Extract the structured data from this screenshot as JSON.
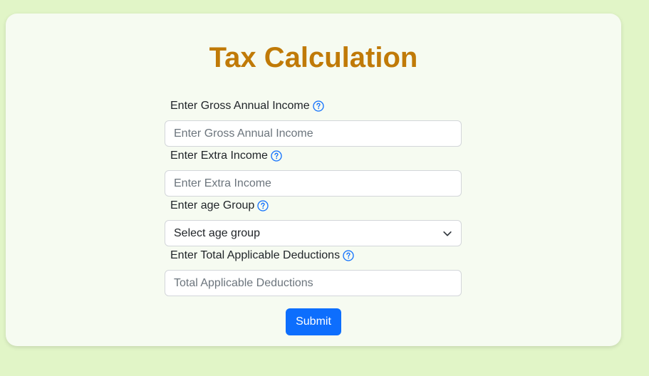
{
  "form": {
    "title": "Tax Calculation",
    "gross_income": {
      "label": "Enter Gross Annual Income",
      "placeholder": "Enter Gross Annual Income",
      "value": ""
    },
    "extra_income": {
      "label": "Enter Extra Income",
      "placeholder": "Enter Extra Income",
      "value": ""
    },
    "age_group": {
      "label": "Enter age Group",
      "selected": "Select age group"
    },
    "deductions": {
      "label": "Enter Total Applicable Deductions",
      "placeholder": "Total Applicable Deductions",
      "value": ""
    },
    "submit_label": "Submit"
  },
  "icons": {
    "help": "question-circle-icon",
    "select": "chevron-down-icon"
  },
  "colors": {
    "page_background": "#e1f5c7",
    "card_background": "#f6fbf1",
    "title": "#c07a07",
    "accent": "#0d6efd"
  }
}
